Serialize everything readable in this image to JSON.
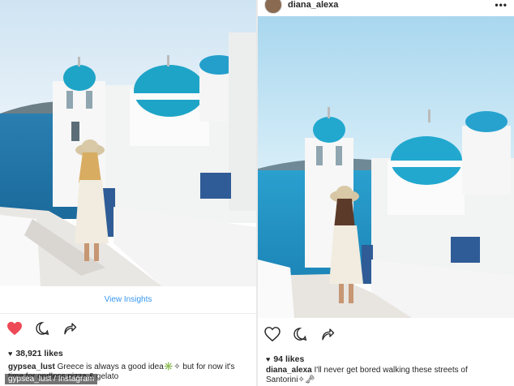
{
  "left_post": {
    "insights_label": "View Insights",
    "likes": "38,921 likes",
    "caption_user": "gypsea_lust",
    "caption_text": "Greece is always a good idea✳️✧ but for now it's time for endless pizza & gelato",
    "liked": true,
    "colors": {
      "liked_heart": "#ed4956",
      "link": "#3897f0"
    }
  },
  "right_post": {
    "username": "diana_alexa",
    "more_label": "•••",
    "likes": "94 likes",
    "caption_user": "diana_alexa",
    "caption_text": "I'll never get bored walking these streets of Santorini✧🗝",
    "liked": false
  },
  "watermark": "gypsea_lust / Instagram",
  "icons": [
    "heart-icon",
    "comment-icon",
    "share-icon",
    "more-icon"
  ]
}
